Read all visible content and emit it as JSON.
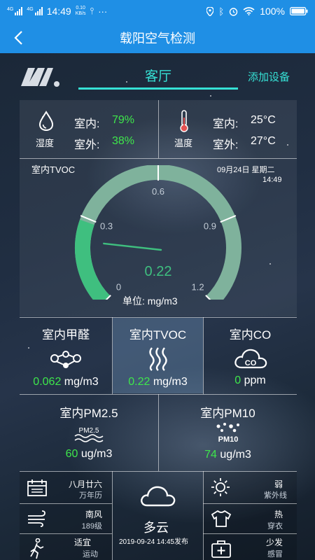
{
  "status_bar": {
    "network1": "4G",
    "network2": "4G",
    "time": "14:49",
    "speed_value": "0.10",
    "speed_unit": "KB/s",
    "more": "···",
    "battery": "100%"
  },
  "header": {
    "title": "载阳空气检测"
  },
  "room": {
    "tab_label": "客厅",
    "add_device_label": "添加设备"
  },
  "humidity": {
    "label": "湿度",
    "indoor_label": "室内:",
    "indoor_value": "79%",
    "outdoor_label": "室外:",
    "outdoor_value": "38%"
  },
  "temperature": {
    "label": "温度",
    "indoor_label": "室内:",
    "indoor_value": "25°C",
    "outdoor_label": "室外:",
    "outdoor_value": "27°C"
  },
  "gauge": {
    "title": "室内TVOC",
    "date": "09月24日 星期二",
    "time": "14:49",
    "ticks": [
      "0",
      "0.3",
      "0.6",
      "0.9",
      "1.2"
    ],
    "value_text": "0.22",
    "value": 0.22,
    "max": 1.2,
    "unit_text": "单位: mg/m3",
    "accent_color": "#3fbf7f"
  },
  "metrics_row1": [
    {
      "title": "室内甲醛",
      "value": "0.062",
      "unit": "mg/m3",
      "icon": "molecule-icon"
    },
    {
      "title": "室内TVOC",
      "value": "0.22",
      "unit": "mg/m3",
      "icon": "wave-icon"
    },
    {
      "title": "室内CO",
      "value": "0",
      "unit": "ppm",
      "icon": "co-cloud-icon"
    }
  ],
  "metrics_row2": [
    {
      "title": "室内PM2.5",
      "value": "60",
      "unit": "ug/m3",
      "icon": "pm25-icon",
      "icon_text": "PM2.5"
    },
    {
      "title": "室内PM10",
      "value": "74",
      "unit": "ug/m3",
      "icon": "pm10-icon",
      "icon_text": "PM10"
    }
  ],
  "weather": {
    "lunar_date": "八月廿六",
    "calendar_label": "万年历",
    "wind_dir": "南风",
    "wind_level": "189级",
    "sport_level": "适宜",
    "sport_label": "运动",
    "condition": "多云",
    "published": "2019-09-24 14:45发布",
    "uv_level": "弱",
    "uv_label": "紫外线",
    "dress_level": "热",
    "dress_label": "穿衣",
    "cold_level": "少发",
    "cold_label": "感冒"
  }
}
